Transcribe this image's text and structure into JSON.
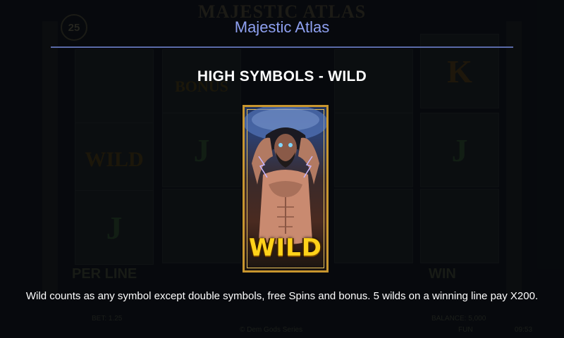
{
  "background": {
    "game_title": "MAJESTIC ATLAS",
    "lines_count": "25",
    "reel_symbols": [
      "",
      "BONUS",
      "",
      "K",
      "WILD",
      "J",
      "",
      "J",
      "J",
      "",
      "",
      ""
    ],
    "labels": {
      "per_line": "PER LINE",
      "win": "WIN",
      "bet": "BET: 1.25",
      "balance": "BALANCE: 5,000",
      "fun": "FUN",
      "time": "09:53",
      "series": "© Dem Gods Series"
    }
  },
  "header": {
    "title": "Majestic Atlas"
  },
  "section": {
    "title": "HIGH SYMBOLS - WILD"
  },
  "symbol_card": {
    "label": "WILD",
    "icon": "atlas-wild-icon"
  },
  "description": {
    "text": "Wild counts as any symbol except double symbols, free Spins and bonus. 5 wilds on a winning line pay X200."
  },
  "colors": {
    "title_blue": "#8ea0f0",
    "rule_blue": "#5a6aa8",
    "card_gold": "#c8962e",
    "wild_yellow": "#ffd21a"
  }
}
